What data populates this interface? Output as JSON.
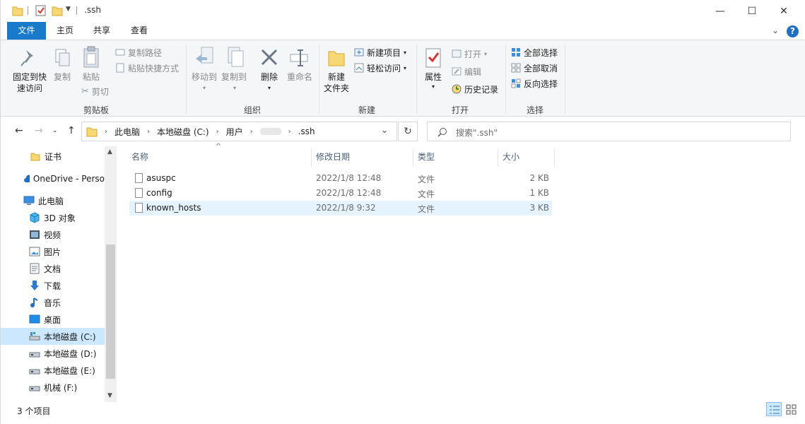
{
  "window": {
    "title": ".ssh",
    "controls": {
      "minimize": "—",
      "maximize": "☐",
      "close": "✕"
    }
  },
  "ribbon_tabs": [
    "文件",
    "主页",
    "共享",
    "查看"
  ],
  "help_label": "?",
  "ribbon": {
    "clipboard": {
      "label": "剪贴板",
      "pin_line1": "固定到快",
      "pin_line2": "速访问",
      "copy": "复制",
      "paste": "粘贴",
      "copy_path": "复制路径",
      "paste_shortcut": "粘贴快捷方式",
      "cut": "剪切"
    },
    "organize": {
      "label": "组织",
      "move_to": "移动到",
      "copy_to": "复制到",
      "delete": "删除",
      "rename": "重命名"
    },
    "new": {
      "label": "新建",
      "new_folder_line1": "新建",
      "new_folder_line2": "文件夹",
      "new_item": "新建项目",
      "easy_access": "轻松访问"
    },
    "open": {
      "label": "打开",
      "properties": "属性",
      "open": "打开",
      "edit": "编辑",
      "history": "历史记录"
    },
    "select": {
      "label": "选择",
      "select_all": "全部选择",
      "select_none": "全部取消",
      "invert": "反向选择"
    }
  },
  "address": {
    "crumbs": [
      "此电脑",
      "本地磁盘 (C:)",
      "用户",
      ".ssh"
    ]
  },
  "search": {
    "placeholder": "搜索\".ssh\""
  },
  "nav_pane": {
    "items": [
      {
        "label": "证书",
        "icon": "folder-icon"
      },
      {
        "label": "OneDrive - Perso",
        "icon": "cloud-icon"
      },
      {
        "label": "此电脑",
        "icon": "computer-icon"
      },
      {
        "label": "3D 对象",
        "icon": "cube-icon"
      },
      {
        "label": "视频",
        "icon": "video-icon"
      },
      {
        "label": "图片",
        "icon": "picture-icon"
      },
      {
        "label": "文档",
        "icon": "document-icon"
      },
      {
        "label": "下载",
        "icon": "download-icon"
      },
      {
        "label": "音乐",
        "icon": "music-icon"
      },
      {
        "label": "桌面",
        "icon": "desktop-icon"
      },
      {
        "label": "本地磁盘 (C:)",
        "icon": "drive-icon"
      },
      {
        "label": "本地磁盘 (D:)",
        "icon": "drive-icon"
      },
      {
        "label": "本地磁盘 (E:)",
        "icon": "drive-icon"
      },
      {
        "label": "机械 (F:)",
        "icon": "drive-icon"
      }
    ]
  },
  "file_list": {
    "columns": [
      "名称",
      "修改日期",
      "类型",
      "大小"
    ],
    "rows": [
      {
        "name": "asuspc",
        "date": "2022/1/8 12:48",
        "type": "文件",
        "size": "2 KB"
      },
      {
        "name": "config",
        "date": "2022/1/8 12:48",
        "type": "文件",
        "size": "1 KB"
      },
      {
        "name": "known_hosts",
        "date": "2022/1/8 9:32",
        "type": "文件",
        "size": "3 KB"
      }
    ]
  },
  "status": {
    "item_count": "3 个项目"
  },
  "colors": {
    "accent": "#1979ca",
    "selection": "#cce8ff",
    "hover": "#e5f3ff",
    "ribbon_bg": "#f5f6f7"
  }
}
